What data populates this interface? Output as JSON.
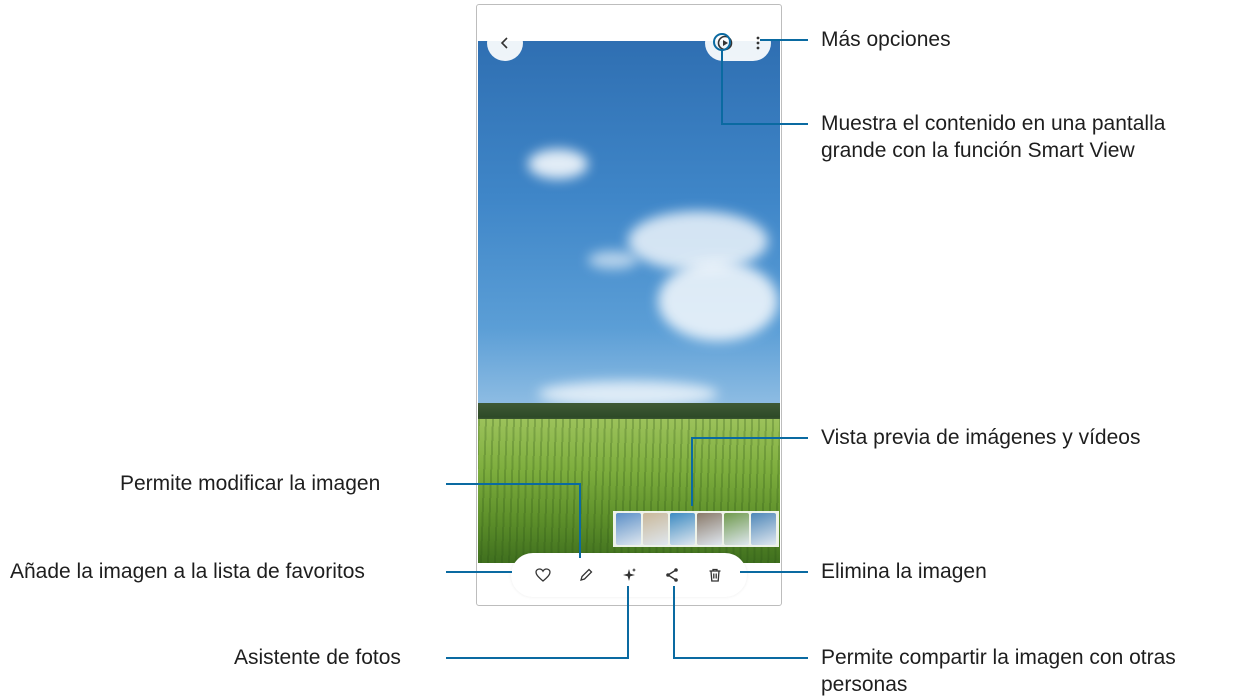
{
  "callouts": {
    "more_options": "Más opciones",
    "smart_view_line1": "Muestra el contenido en una pantalla",
    "smart_view_line2": "grande con la función Smart View",
    "preview": "Vista previa de imágenes y vídeos",
    "edit": "Permite modificar la imagen",
    "favorite": "Añade la imagen a la lista de favoritos",
    "delete": "Elimina la imagen",
    "assistant": "Asistente de fotos",
    "share_line1": "Permite compartir la imagen con otras",
    "share_line2": "personas"
  },
  "icons": {
    "back": "chevron-left-icon",
    "smart_view": "smart-view-icon",
    "more": "more-vertical-icon",
    "favorite": "heart-icon",
    "edit": "pencil-icon",
    "assistant": "sparkle-icon",
    "share": "share-icon",
    "delete": "trash-icon"
  },
  "thumbnails": [
    {
      "color": "#5b8fc7"
    },
    {
      "color": "#c9b89a"
    },
    {
      "color": "#3d8bc2"
    },
    {
      "color": "#8a7a6a"
    },
    {
      "color": "#6f9a4c"
    },
    {
      "color": "#4e87b8"
    }
  ],
  "colors": {
    "callout_line": "#0a6aa1",
    "accent": "#0a6aa1"
  }
}
